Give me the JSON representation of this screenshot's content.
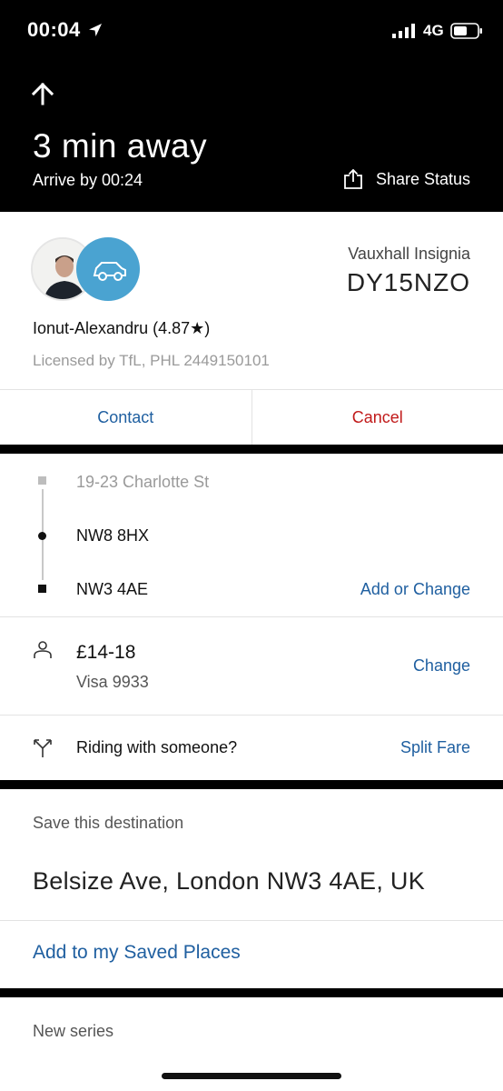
{
  "status_bar": {
    "time": "00:04",
    "network": "4G"
  },
  "header": {
    "eta": "3 min away",
    "arrive_by": "Arrive by 00:24",
    "share_label": "Share Status"
  },
  "driver": {
    "car_model": "Vauxhall Insignia",
    "plate": "DY15NZO",
    "name_rating": "Ionut-Alexandru (4.87★)",
    "licence": "Licensed by TfL, PHL 2449150101"
  },
  "actions": {
    "contact": "Contact",
    "cancel": "Cancel"
  },
  "route": {
    "pickup": "19-23 Charlotte St",
    "stop": "NW8 8HX",
    "destination": "NW3 4AE",
    "add_change": "Add or Change"
  },
  "payment": {
    "fare": "£14-18",
    "card": "Visa 9933",
    "change": "Change"
  },
  "split": {
    "prompt": "Riding with someone?",
    "action": "Split Fare"
  },
  "save_destination": {
    "title": "Save this destination",
    "address": "Belsize Ave, London NW3 4AE, UK",
    "action": "Add to my Saved Places"
  },
  "next_section": {
    "title": "New series"
  },
  "colors": {
    "link": "#1f5fa0",
    "cancel": "#c11a1a",
    "car_badge": "#4aa3d1",
    "header_bg": "#000000"
  },
  "icons": [
    "location-arrow-icon",
    "signal-icon",
    "battery-icon",
    "up-arrow-icon",
    "share-icon",
    "car-icon",
    "person-icon",
    "split-icon"
  ]
}
